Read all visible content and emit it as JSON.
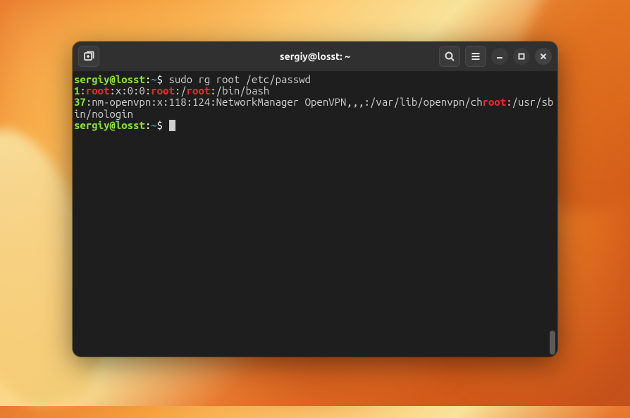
{
  "titlebar": {
    "title": "sergiy@losst: ~"
  },
  "prompt": {
    "user": "sergiy",
    "at": "@",
    "host": "losst",
    "colon": ":",
    "path": "~",
    "symbol": "$"
  },
  "lines": {
    "cmd1": "sudo rg root /etc/passwd",
    "l2_num": "1",
    "l2_a": ":",
    "l2_match1": "root",
    "l2_b": ":x:0:0:",
    "l2_match2": "root",
    "l2_c": ":/",
    "l2_match3": "root",
    "l2_d": ":/bin/bash",
    "l3_num": "37",
    "l3_a": ":nm-openvpn:x:118:124:NetworkManager OpenVPN,,,:/var/lib/openvpn/ch",
    "l3_match": "root",
    "l3_b": ":/usr/sbin/nologin"
  },
  "icons": {
    "new_tab": "new-tab-icon",
    "search": "search-icon",
    "menu": "hamburger-icon",
    "minimize": "minimize-icon",
    "maximize": "maximize-icon",
    "close": "close-icon"
  }
}
